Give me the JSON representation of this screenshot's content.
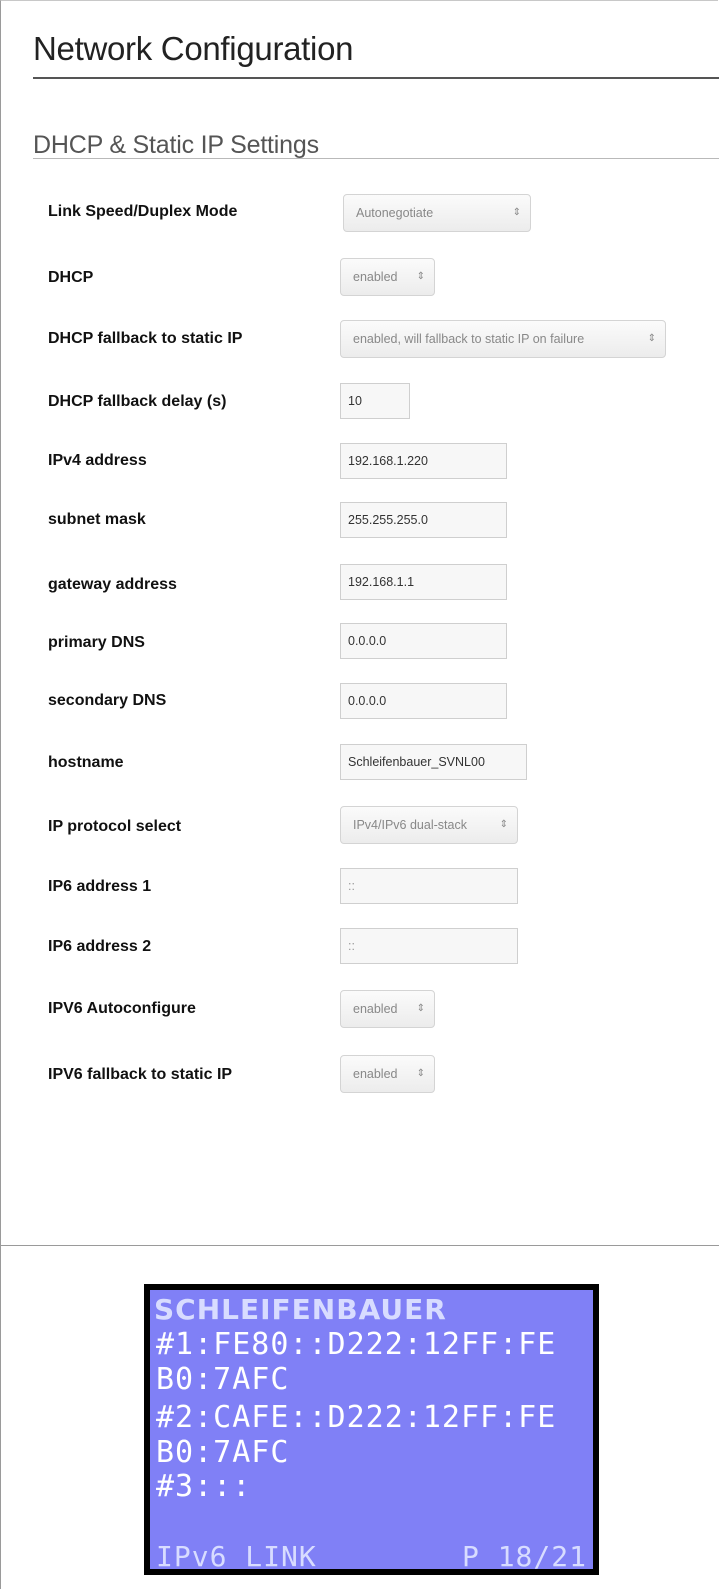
{
  "page": {
    "title": "Network Configuration",
    "section_title": "DHCP & Static IP Settings"
  },
  "fields": {
    "link_speed": {
      "label": "Link Speed/Duplex Mode",
      "value": "Autonegotiate"
    },
    "dhcp": {
      "label": "DHCP",
      "value": "enabled"
    },
    "dhcp_fallback": {
      "label": "DHCP fallback to static IP",
      "value": "enabled, will fallback to static IP on failure"
    },
    "dhcp_fallback_delay": {
      "label": "DHCP fallback delay (s)",
      "value": "10"
    },
    "ipv4_address": {
      "label": "IPv4 address",
      "value": "192.168.1.220"
    },
    "subnet_mask": {
      "label": "subnet mask",
      "value": "255.255.255.0"
    },
    "gateway_address": {
      "label": "gateway address",
      "value": "192.168.1.1"
    },
    "primary_dns": {
      "label": "primary DNS",
      "value": "0.0.0.0"
    },
    "secondary_dns": {
      "label": "secondary DNS",
      "value": "0.0.0.0"
    },
    "hostname": {
      "label": "hostname",
      "value": "Schleifenbauer_SVNL00"
    },
    "ip_protocol": {
      "label": "IP protocol select",
      "value": "IPv4/IPv6 dual-stack"
    },
    "ip6_address_1": {
      "label": "IP6 address 1",
      "value": "::"
    },
    "ip6_address_2": {
      "label": "IP6 address 2",
      "value": "::"
    },
    "ipv6_autoconfigure": {
      "label": "IPV6 Autoconfigure",
      "value": "enabled"
    },
    "ipv6_fallback": {
      "label": "IPV6 fallback to static IP",
      "value": "enabled"
    }
  },
  "icons": {
    "select_arrows": "up-down-arrows-icon",
    "select_arrows_glyph": "⇕"
  },
  "lcd": {
    "brand": "SCHLEIFENBAUER",
    "lines": [
      "#1:FE80::D222:12FF:FE",
      "B0:7AFC",
      "#2:CAFE::D222:12FF:FE",
      "B0:7AFC",
      "#3:::"
    ],
    "footer_left": "IPv6 LINK",
    "footer_right": "P 18/21",
    "colors": {
      "background": "#8080f6",
      "text": "#ffffff",
      "border": "#000000"
    }
  }
}
